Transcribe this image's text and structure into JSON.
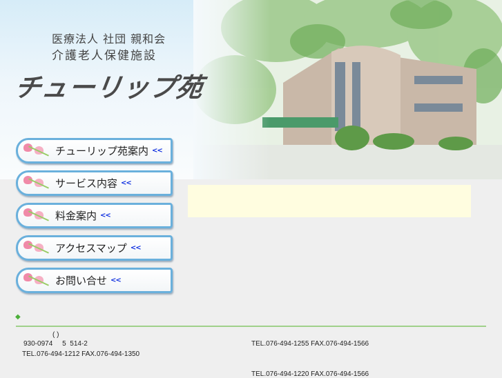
{
  "header": {
    "org_line1": "医療法人 社団 親和会",
    "org_line2": "介護老人保健施設",
    "logo": "チューリップ苑"
  },
  "nav": [
    {
      "label": "チューリップ苑案内",
      "arrow": "<<"
    },
    {
      "label": "サービス内容",
      "arrow": "<<"
    },
    {
      "label": "料金案内",
      "arrow": "<<"
    },
    {
      "label": "アクセスマップ",
      "arrow": "<<"
    },
    {
      "label": "お問い合せ",
      "arrow": "<<"
    }
  ],
  "footer": {
    "bullet": "◆",
    "paren": "(          )",
    "address": "930-0974     5  514-2",
    "main_tel": "TEL.076-494-1212 FAX.076-494-1350",
    "tel2": "TEL.076-494-1255 FAX.076-494-1566",
    "tel3": "TEL.076-494-1220 FAX.076-494-1566"
  },
  "colors": {
    "nav_border": "#6ab0dc",
    "rule": "#9fd08a",
    "notice_bg": "#fffde0"
  }
}
